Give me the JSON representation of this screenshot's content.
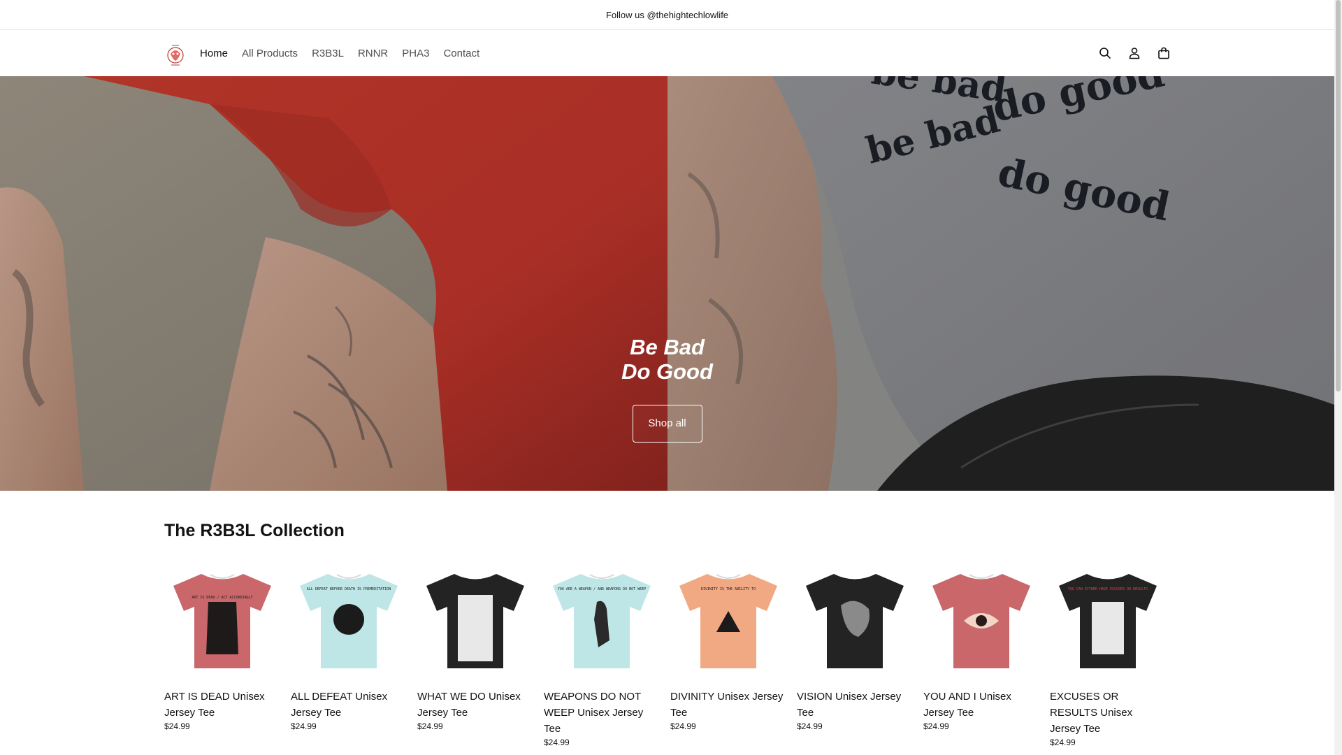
{
  "announcement": {
    "text": "Follow us @thehightechlowlife"
  },
  "nav": {
    "items": [
      {
        "label": "Home",
        "active": true
      },
      {
        "label": "All Products",
        "active": false
      },
      {
        "label": "R3B3L",
        "active": false
      },
      {
        "label": "RNNR",
        "active": false
      },
      {
        "label": "PHA3",
        "active": false
      },
      {
        "label": "Contact",
        "active": false
      }
    ]
  },
  "header_icons": [
    "search-icon",
    "account-icon",
    "cart-icon"
  ],
  "hero": {
    "title_line1": "Be Bad",
    "title_line2": "Do Good",
    "button_label": "Shop all",
    "shirt_text": [
      "be bad",
      "do good",
      "be bad",
      "do good"
    ]
  },
  "collection": {
    "title": "The R3B3L Collection",
    "products": [
      {
        "title": "ART IS DEAD Unisex Jersey Tee",
        "price": "$24.99",
        "shirt_color": "#c9676b",
        "print_text": "ART IS DEAD / ACT ACCORDINGLY"
      },
      {
        "title": "ALL DEFEAT Unisex Jersey Tee",
        "price": "$24.99",
        "shirt_color": "#bfe6e6",
        "print_text": "ALL DEFEAT BEFORE DEATH IS PREMEDITATION"
      },
      {
        "title": "WHAT WE DO Unisex Jersey Tee",
        "price": "$24.99",
        "shirt_color": "#232323",
        "print_text": ""
      },
      {
        "title": "WEAPONS DO NOT WEEP Unisex Jersey Tee",
        "price": "$24.99",
        "shirt_color": "#bfe6e6",
        "print_text": "YOU ARE A WEAPON / AND WEAPONS DO NOT WEEP"
      },
      {
        "title": "DIVINITY Unisex Jersey Tee",
        "price": "$24.99",
        "shirt_color": "#f1a983",
        "print_text": "DIVINITY IS THE ABILITY TO"
      },
      {
        "title": "VISION Unisex Jersey Tee",
        "price": "$24.99",
        "shirt_color": "#232323",
        "print_text": ""
      },
      {
        "title": "YOU AND I Unisex Jersey Tee",
        "price": "$24.99",
        "shirt_color": "#c9676b",
        "print_text": ""
      },
      {
        "title": "EXCUSES OR RESULTS Unisex Jersey Tee",
        "price": "$24.99",
        "shirt_color": "#232323",
        "print_text": "YOU CAN EITHER HAVE EXCUSES OR RESULTS"
      }
    ]
  }
}
